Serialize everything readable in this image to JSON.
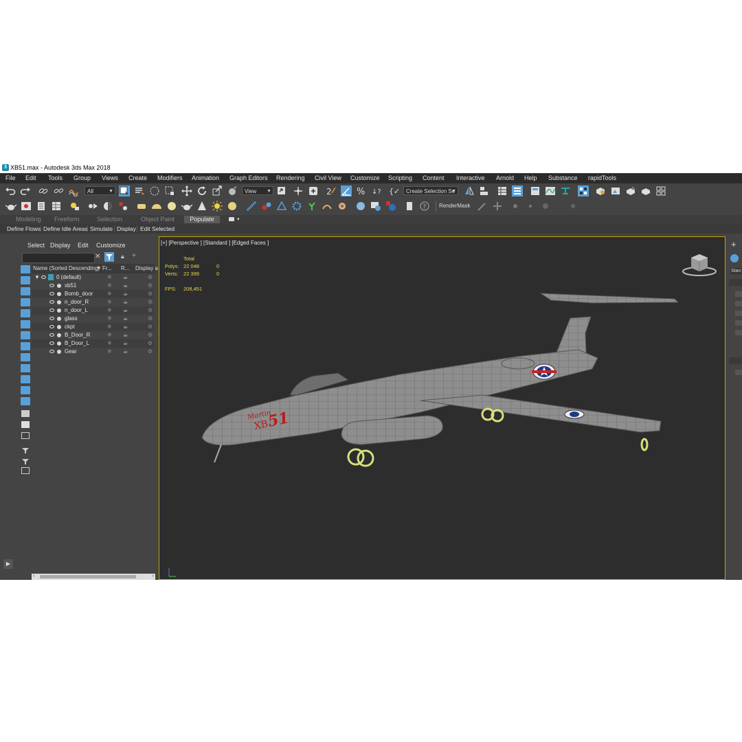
{
  "window": {
    "title": "XB51.max - Autodesk 3ds Max 2018"
  },
  "menu": [
    "File",
    "Edit",
    "Tools",
    "Group",
    "Views",
    "Create",
    "Modifiers",
    "Animation",
    "Graph Editors",
    "Rendering",
    "Civil View",
    "Customize",
    "Scripting",
    "Content",
    "Interactive",
    "Arnold",
    "Help",
    "Substance",
    "rapidTools"
  ],
  "toolbar": {
    "filter_value": "All",
    "coord_value": "View",
    "selection_set_placeholder": "Create Selection Se",
    "rendermask_label": "RenderMask"
  },
  "ribbon": {
    "tabs": [
      "Modeling",
      "Freeform",
      "Selection",
      "Object Paint",
      "Populate"
    ],
    "active_tab": "Populate",
    "subitems": [
      "Define Flows",
      "Define Idle Areas",
      "Simulate",
      "Display",
      "Edit Selected"
    ]
  },
  "scene_explorer": {
    "menu": [
      "Select",
      "Display",
      "Edit",
      "Customize"
    ],
    "columns": {
      "name": "Name (Sorted Descending)",
      "frozen": "Fr...",
      "render": "R...",
      "display": "Display a"
    },
    "layer": "0 (default)",
    "objects": [
      "xb51",
      "Bomb_door",
      "n_door_R",
      "n_door_L",
      "glass",
      "ckpt",
      "B_Door_R",
      "B_Door_L",
      "Gear"
    ]
  },
  "viewport": {
    "label": "[+] [Perspective ] [Standard ] [Edged Faces ]",
    "stats": {
      "total_label": "Total",
      "polys_label": "Polys:",
      "polys_value": "22 048",
      "polys_sel": "0",
      "verts_label": "Verts:",
      "verts_value": "22 399",
      "verts_sel": "0",
      "fps_label": "FPS:",
      "fps_value": "208,451"
    },
    "decal_script": "Martin",
    "decal_code": "XB",
    "decal_number": "51"
  },
  "right_panel": {
    "tab_label": "Stan"
  },
  "colors": {
    "viewport_border": "#c8a000",
    "stats_text": "#e8d84a",
    "selection_blue": "#5aa0d8"
  }
}
